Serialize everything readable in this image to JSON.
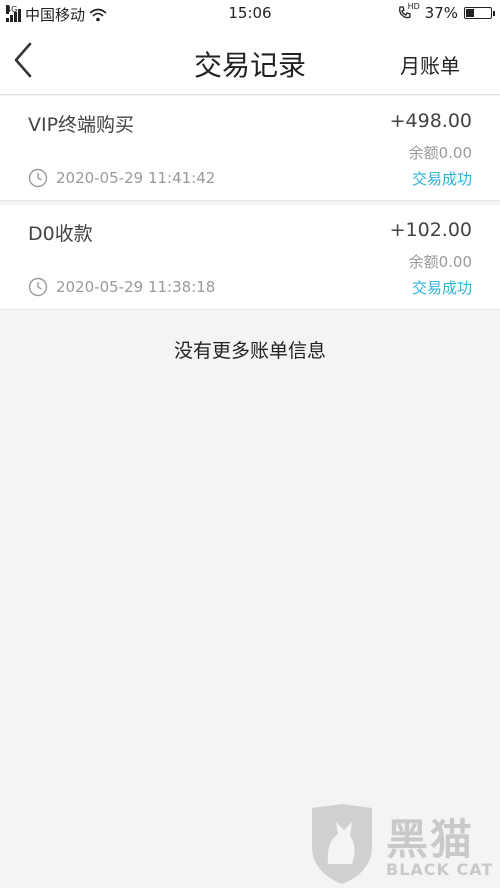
{
  "status_bar": {
    "network_tag": "4G",
    "carrier": "中国移动",
    "time": "15:06",
    "hd_tag": "HD",
    "battery_percent": "37%",
    "battery_level": 0.37
  },
  "header": {
    "title": "交易记录",
    "right_label": "月账单"
  },
  "records": [
    {
      "title": "VIP终端购买",
      "amount": "+498.00",
      "balance": "余额0.00",
      "datetime": "2020-05-29 11:41:42",
      "status": "交易成功"
    },
    {
      "title": "D0收款",
      "amount": "+102.00",
      "balance": "余额0.00",
      "datetime": "2020-05-29 11:38:18",
      "status": "交易成功"
    }
  ],
  "footer_note": "没有更多账单信息",
  "watermark": {
    "text": "黑猫",
    "sub": "BLACK CAT"
  },
  "colors": {
    "status_success": "#2bb3d6",
    "background": "#f4f4f6"
  }
}
